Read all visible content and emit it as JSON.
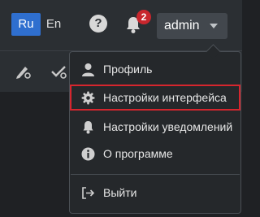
{
  "header": {
    "lang_ru": "Ru",
    "lang_en": "En",
    "help_icon": "?",
    "notifications_count": "2",
    "user_name": "admin"
  },
  "user_menu": {
    "items": [
      {
        "icon": "user-icon",
        "label": "Профиль"
      },
      {
        "icon": "gear-icon",
        "label": "Настройки интерфейса",
        "highlighted": true
      },
      {
        "icon": "bell-icon",
        "label": "Настройки уведомлений"
      },
      {
        "icon": "info-icon",
        "label": "О программе"
      },
      {
        "icon": "logout-icon",
        "label": "Выйти"
      }
    ]
  },
  "colors": {
    "accent_blue": "#2f6fcf",
    "badge_red": "#c8262d",
    "highlight_red": "#d6262e"
  }
}
